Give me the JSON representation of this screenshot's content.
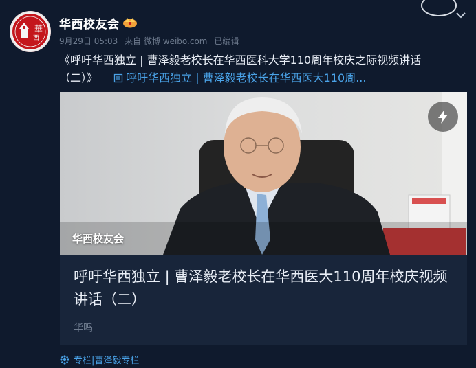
{
  "post": {
    "username": "华西校友会",
    "date": "9月29日 05:03",
    "source": "来自 微博 weibo.com",
    "edited": "已编辑",
    "text": "《呼吁华西独立 | 曹泽毅老校长在华西医科大学110周年校庆之际视频讲话",
    "text_cont": "（二）》",
    "link_text": "呼吁华西独立 | 曹泽毅老校长在华西医大110周...",
    "vip_icon": "vip-crown-icon",
    "avatar_icon": "wcums-seal-logo"
  },
  "card": {
    "source_label": "华西校友会",
    "title": "呼吁华西独立 | 曹泽毅老校长在华西医大110周年校庆视频讲话（二）",
    "author": "华鸣",
    "badge_icon": "lightning-icon"
  },
  "footer": {
    "column_label": "专栏|曹泽毅专栏",
    "column_icon": "column-icon"
  },
  "colors": {
    "background": "#0f1a2d",
    "card": "#18253a",
    "link": "#4aa3e8",
    "avatar": "#c4161c"
  }
}
